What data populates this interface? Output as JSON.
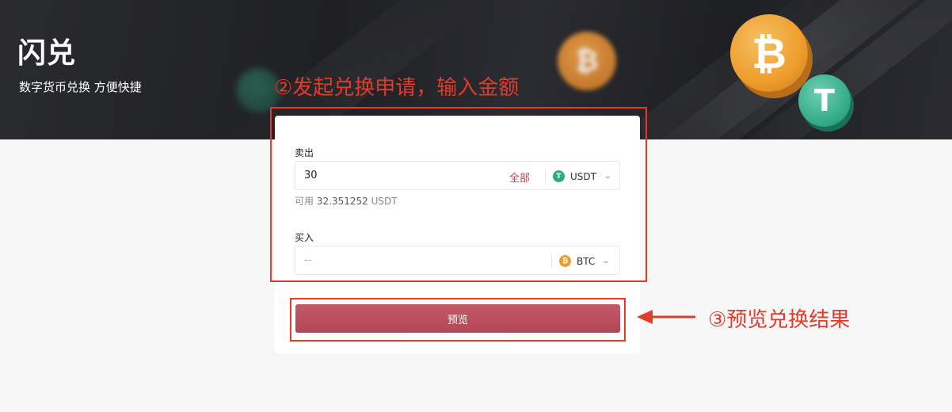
{
  "banner": {
    "title": "闪兑",
    "subtitle": "数字货币兑换 方便快捷"
  },
  "sell": {
    "label": "卖出",
    "amount": "30",
    "all_label": "全部",
    "coin": "USDT",
    "coin_icon": "usdt-icon",
    "available_prefix": "可用",
    "available_amount": "32.351252",
    "available_unit": "USDT"
  },
  "buy": {
    "label": "买入",
    "placeholder": "--",
    "coin": "BTC",
    "coin_icon": "btc-icon"
  },
  "preview_button": "预览",
  "annotations": {
    "step2": "②发起兑换申请，输入金额",
    "step3": "③预览兑换结果"
  },
  "colors": {
    "accent": "#b24756",
    "annotation": "#e23b2a",
    "usdt": "#2fa884",
    "btc": "#ee9d2b"
  }
}
